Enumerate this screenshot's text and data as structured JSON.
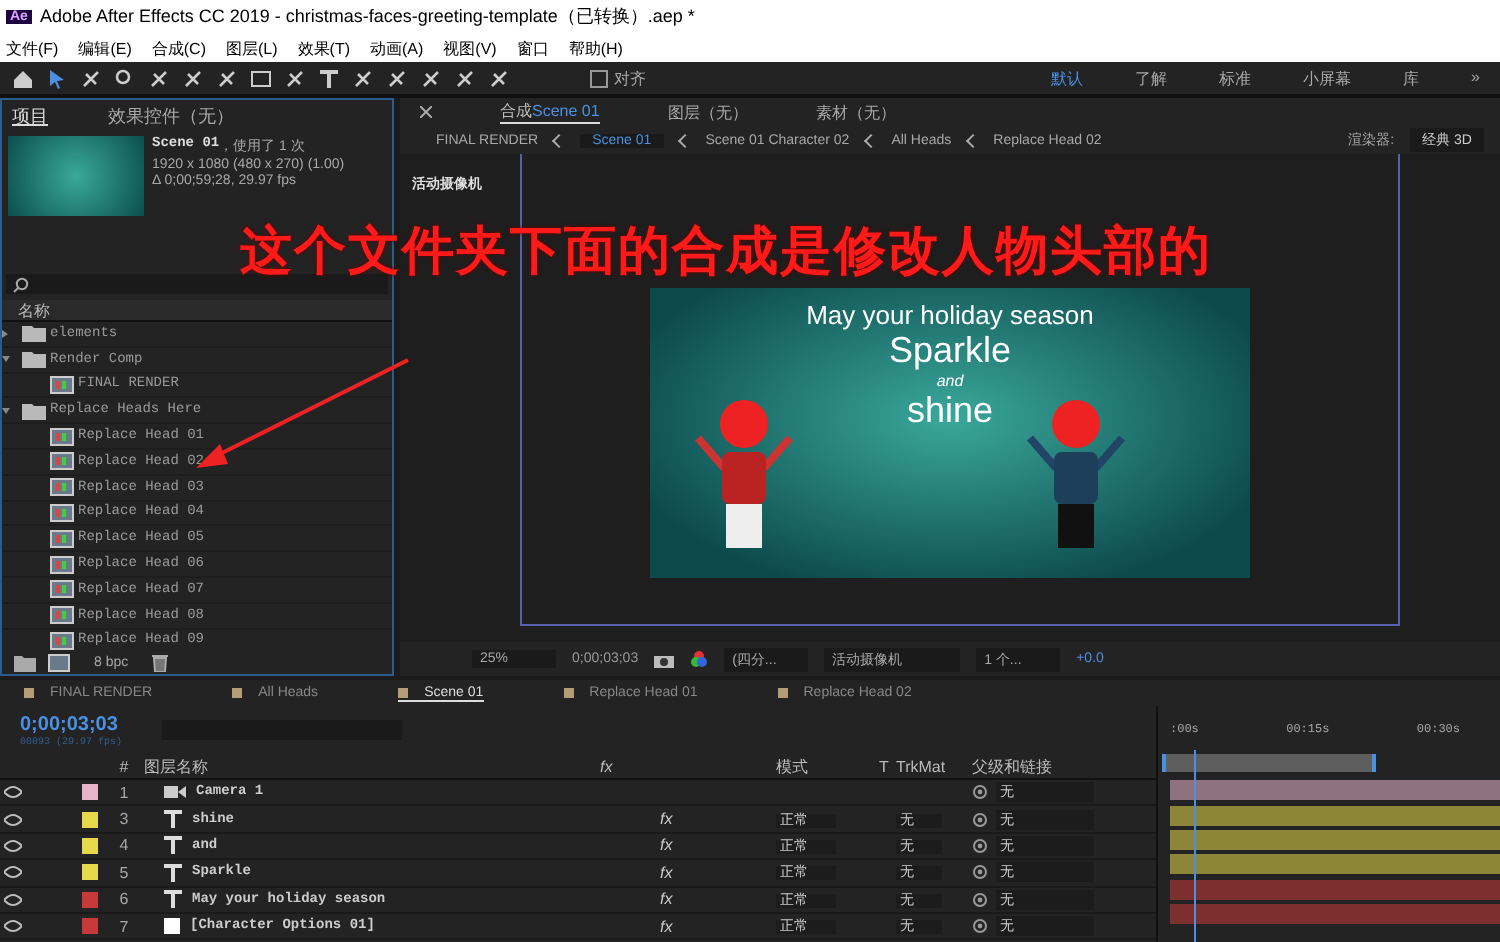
{
  "window": {
    "title": "Adobe After Effects CC 2019 - christmas-faces-greeting-template（已转换）.aep *",
    "app_badge": "Ae"
  },
  "menu": [
    "文件(F)",
    "编辑(E)",
    "合成(C)",
    "图层(L)",
    "效果(T)",
    "动画(A)",
    "视图(V)",
    "窗口",
    "帮助(H)"
  ],
  "toolbar": {
    "snap_label": "对齐",
    "snap_checked": false,
    "workspaces": [
      {
        "label": "默认",
        "selected": true
      },
      {
        "label": "了解",
        "selected": false
      },
      {
        "label": "标准",
        "selected": false
      },
      {
        "label": "小屏幕",
        "selected": false
      },
      {
        "label": "库",
        "selected": false
      }
    ],
    "overflow": "»"
  },
  "project": {
    "tabs": [
      {
        "label": "项目",
        "selected": true
      },
      {
        "label": "效果控件（无）",
        "selected": false
      }
    ],
    "preview": {
      "name": "Scene 01",
      "usage": "，使用了 1 次",
      "size": "1920 x 1080  (480 x 270) (1.00)",
      "duration": "Δ 0;00;59;28, 29.97 fps"
    },
    "column": "名称",
    "items": [
      {
        "name": "elements",
        "kind": "folder",
        "expanded": false
      },
      {
        "name": "Render Comp",
        "kind": "folder",
        "expanded": true,
        "children": [
          {
            "name": "FINAL RENDER",
            "kind": "comp"
          }
        ]
      },
      {
        "name": "Replace Heads Here",
        "kind": "folder",
        "expanded": true,
        "children": [
          {
            "name": "Replace Head 01",
            "kind": "comp"
          },
          {
            "name": "Replace Head 02",
            "kind": "comp"
          },
          {
            "name": "Replace Head 03",
            "kind": "comp"
          },
          {
            "name": "Replace Head 04",
            "kind": "comp"
          },
          {
            "name": "Replace Head 05",
            "kind": "comp"
          },
          {
            "name": "Replace Head 06",
            "kind": "comp"
          },
          {
            "name": "Replace Head 07",
            "kind": "comp"
          },
          {
            "name": "Replace Head 08",
            "kind": "comp"
          },
          {
            "name": "Replace Head 09",
            "kind": "comp"
          }
        ]
      }
    ],
    "bit_depth": "8 bpc"
  },
  "composition": {
    "tabs": [
      {
        "prefix": "合成",
        "label": "Scene 01",
        "selected": true
      },
      {
        "label": "图层（无）",
        "selected": false
      },
      {
        "label": "素材（无）",
        "selected": false
      }
    ],
    "breadcrumbs": [
      {
        "label": "FINAL RENDER",
        "selected": false
      },
      {
        "label": "Scene 01",
        "selected": true
      },
      {
        "label": "Scene 01 Character 02",
        "selected": false
      },
      {
        "label": "All Heads",
        "selected": false
      },
      {
        "label": "Replace Head 02",
        "selected": false
      }
    ],
    "renderer_label": "渲染器:",
    "renderer": "经典 3D",
    "camera_label": "活动摄像机",
    "scene_texts": [
      "May your holiday season",
      "Sparkle",
      "and",
      "shine"
    ],
    "zoom": "25%",
    "timecode": "0;00;03;03",
    "resolution": "(四分...",
    "view": "活动摄像机",
    "views": "1 个...",
    "exposure": "+0.0"
  },
  "annotation": "这个文件夹下面的合成是修改人物头部的",
  "timeline": {
    "tabs": [
      {
        "label": "FINAL RENDER",
        "selected": false
      },
      {
        "label": "All Heads",
        "selected": false
      },
      {
        "label": "Scene 01",
        "selected": true
      },
      {
        "label": "Replace Head 01",
        "selected": false
      },
      {
        "label": "Replace Head 02",
        "selected": false
      }
    ],
    "timecode": "0;00;03;03",
    "frame_info": "00093 (29.97 fps)",
    "columns": {
      "num": "#",
      "name": "图层名称",
      "fx": "fx",
      "mode": "模式",
      "t": "T",
      "trkmat": "TrkMat",
      "parent": "父级和链接"
    },
    "ruler": [
      ":00s",
      "00:15s",
      "00:30s"
    ],
    "layers": [
      {
        "num": "1",
        "name": "Camera 1",
        "kind": "camera",
        "color": "#e8b4c8",
        "parent": "无"
      },
      {
        "num": "3",
        "name": "shine",
        "kind": "text",
        "color": "#e6d84a",
        "fx": "fx",
        "effects_on": true,
        "mode": "正常",
        "trkmat": "无",
        "parent": "无"
      },
      {
        "num": "4",
        "name": "and",
        "kind": "text",
        "color": "#e6d84a",
        "fx": "fx",
        "effects_on": true,
        "mode": "正常",
        "trkmat": "无",
        "parent": "无"
      },
      {
        "num": "5",
        "name": "Sparkle",
        "kind": "text",
        "color": "#e6d84a",
        "fx": "fx",
        "effects_on": true,
        "mode": "正常",
        "trkmat": "无",
        "parent": "无"
      },
      {
        "num": "6",
        "name": "May your holiday season",
        "kind": "text",
        "color": "#c83a3a",
        "fx": "fx",
        "effects_on": true,
        "mode": "正常",
        "trkmat": "无",
        "parent": "无"
      },
      {
        "num": "7",
        "name": "[Character Options 01]",
        "kind": "solid",
        "color": "#c83a3a",
        "fx": "fx",
        "effects_on": true,
        "mode": "正常",
        "trkmat": "无",
        "parent": "无"
      }
    ]
  }
}
